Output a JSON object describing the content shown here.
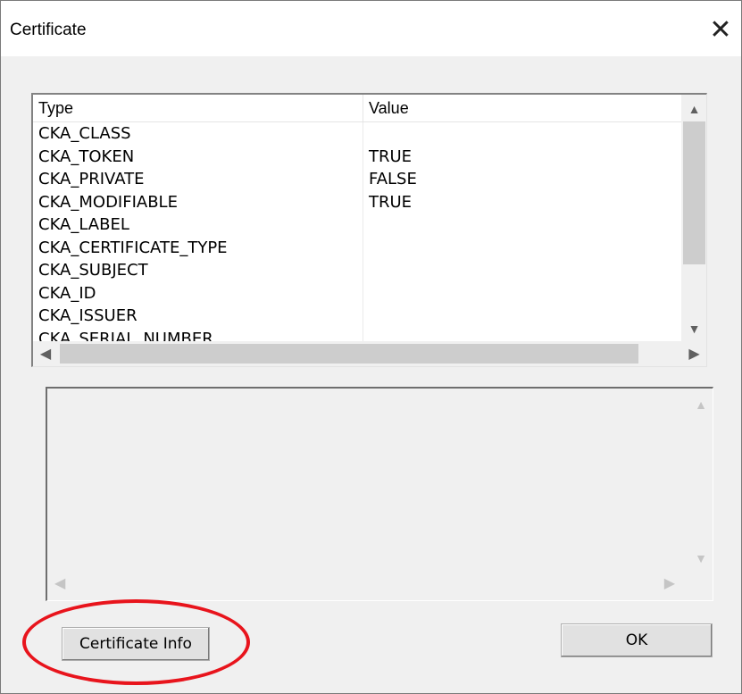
{
  "window": {
    "title": "Certificate"
  },
  "listview": {
    "columns": [
      "Type",
      "Value"
    ],
    "rows": [
      {
        "type": "CKA_CLASS",
        "value": ""
      },
      {
        "type": "CKA_TOKEN",
        "value": "TRUE"
      },
      {
        "type": "CKA_PRIVATE",
        "value": "FALSE"
      },
      {
        "type": "CKA_MODIFIABLE",
        "value": "TRUE"
      },
      {
        "type": "CKA_LABEL",
        "value": ""
      },
      {
        "type": "CKA_CERTIFICATE_TYPE",
        "value": ""
      },
      {
        "type": "CKA_SUBJECT",
        "value": ""
      },
      {
        "type": "CKA_ID",
        "value": ""
      },
      {
        "type": "CKA_ISSUER",
        "value": ""
      },
      {
        "type": "CKA_SERIAL_NUMBER",
        "value": ""
      }
    ]
  },
  "buttons": {
    "certificate_info": "Certificate Info",
    "ok": "OK"
  },
  "icons": {
    "close": "close-icon",
    "scroll_up": "chevron-up-icon",
    "scroll_down": "chevron-down-icon",
    "scroll_left": "chevron-left-icon",
    "scroll_right": "chevron-right-icon"
  },
  "annotation": {
    "color": "#e8141c",
    "target": "certificate-info-button"
  }
}
